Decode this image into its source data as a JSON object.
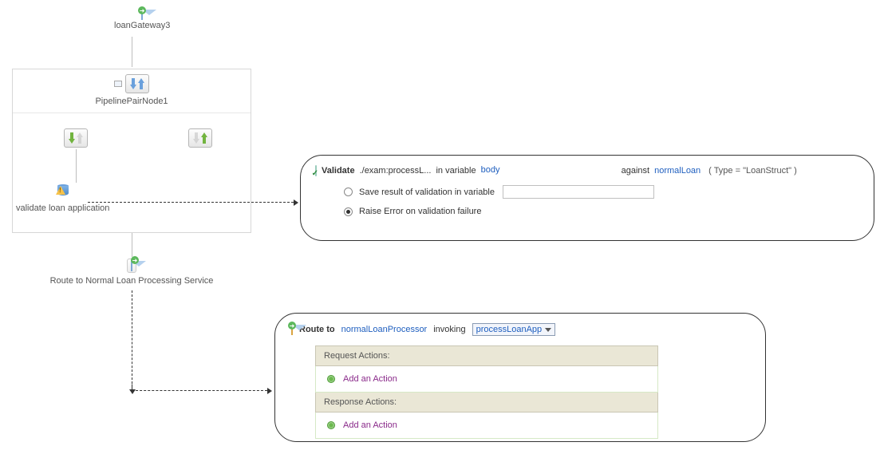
{
  "gateway": {
    "label": "loanGateway3"
  },
  "pipeline": {
    "title": "PipelinePairNode1"
  },
  "validate_node": {
    "label": "validate loan application"
  },
  "route_node": {
    "label": "Route to Normal Loan Processing Service"
  },
  "validate_panel": {
    "title_prefix": "Validate",
    "xpath": "./exam:processL...",
    "in_variable_text": "in variable",
    "variable": "body",
    "against_text": "against",
    "schema": "normalLoan",
    "schema_type": "( Type = \"LoanStruct\" )",
    "opt_save_label": "Save result of validation in variable",
    "opt_raise_label": "Raise Error on validation failure",
    "save_value": ""
  },
  "route_panel": {
    "title_prefix": "Route to",
    "service": "normalLoanProcessor",
    "invoking_text": "invoking",
    "operation": "processLoanApp",
    "request_hdr": "Request Actions:",
    "response_hdr": "Response Actions:",
    "add_action": "Add an Action"
  }
}
